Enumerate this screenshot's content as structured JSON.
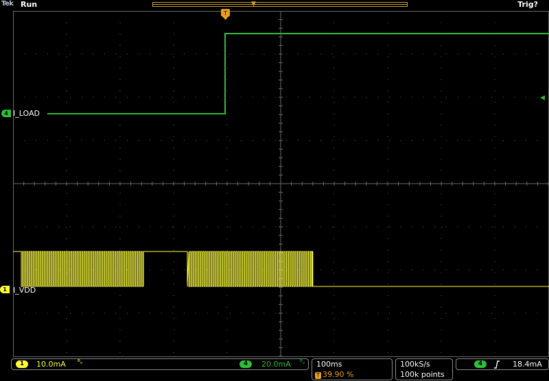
{
  "status": {
    "brand": "Tek",
    "state": "Run",
    "trigger_state": "Trig?"
  },
  "channels": {
    "ch4": {
      "number": "4",
      "label": "I_LOAD",
      "scale": "20.0mA",
      "color": "#2fbf3a"
    },
    "ch1": {
      "number": "1",
      "label": "I_VDD",
      "scale": "10.0mA",
      "color": "#ffff40"
    }
  },
  "bw_symbol": "ᴮᵥ",
  "timebase": {
    "time_per_div": "100ms",
    "trigger_position": "39.90 %",
    "sample_rate": "100kS/s",
    "record_length": "100k points"
  },
  "trigger": {
    "source": "4",
    "slope_icon": "rising-edge-icon",
    "level": "18.4mA"
  },
  "colors": {
    "grid": "#6a6a6a",
    "accent_orange": "#e8a020"
  }
}
